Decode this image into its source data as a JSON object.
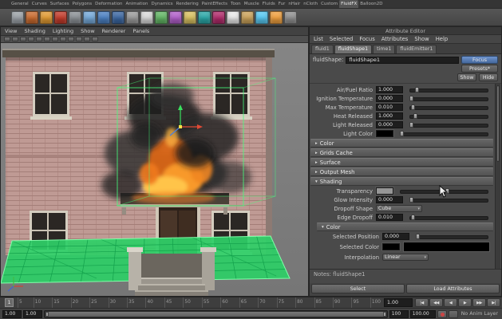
{
  "shelf": {
    "tabs": [
      "General",
      "Curves",
      "Surfaces",
      "Polygons",
      "Deformation",
      "Animation",
      "Dynamics",
      "Rendering",
      "PaintEffects",
      "Toon",
      "Muscle",
      "Fluids",
      "Fur",
      "nHair",
      "nCloth",
      "Custom",
      "FluidFX",
      "Balloon2D"
    ],
    "active_tab": "FluidFX",
    "icon_colors": [
      "#9aa0a6",
      "#c96a2e",
      "#e09a32",
      "#c23b2a",
      "#8a8f94",
      "#74a8d8",
      "#4a7fc1",
      "#3b66a0",
      "#9a9a9a",
      "#d9d9d9",
      "#62b564",
      "#b05fc9",
      "#d8c060",
      "#2aa7a7",
      "#b02a6a",
      "#e8e8e8",
      "#caa25a",
      "#57c8f2",
      "#ef9f3e",
      "#8f8f8f"
    ]
  },
  "viewport": {
    "menu": [
      "View",
      "Shading",
      "Lighting",
      "Show",
      "Renderer",
      "Panels"
    ],
    "toolbar_icons": [
      "select-icon",
      "lasso-icon",
      "paint-select-icon",
      "grid-snap-icon",
      "curve-snap-icon",
      "point-snap-icon",
      "view-snap-icon",
      "make-live-icon",
      "camera-icon",
      "light-icon",
      "texture-icon",
      "wireframe-icon"
    ]
  },
  "attribute_editor": {
    "title": "Attribute Editor",
    "menu": [
      "List",
      "Selected",
      "Focus",
      "Attributes",
      "Show",
      "Help"
    ],
    "tabs": [
      {
        "label": "fluid1",
        "active": false
      },
      {
        "label": "fluidShape1",
        "active": true
      },
      {
        "label": "time1",
        "active": false
      },
      {
        "label": "fluidEmitter1",
        "active": false
      }
    ],
    "node": {
      "label": "fluidShape:",
      "value": "fluidShape1"
    },
    "actions": {
      "focus": "Focus",
      "presets": "Presets*",
      "show": "Show",
      "hide": "Hide"
    },
    "top_rows": [
      {
        "type": "num",
        "label": "Air/Fuel Ratio",
        "value": "1.000",
        "t": 0.08
      },
      {
        "type": "num",
        "label": "Ignition Temperature",
        "value": "0.000",
        "t": 0.0
      },
      {
        "type": "num",
        "label": "Max Temperature",
        "value": "0.010",
        "t": 0.02
      },
      {
        "type": "num",
        "label": "Heat Released",
        "value": "1.000",
        "t": 0.05
      },
      {
        "type": "num",
        "label": "Light Released",
        "value": "0.000",
        "t": 0.0
      },
      {
        "type": "color",
        "label": "Light Color",
        "swatch": "#000000",
        "t": 0.0
      }
    ],
    "collapsed_sections": [
      {
        "label": "Color"
      },
      {
        "label": "Grids Cache"
      },
      {
        "label": "Surface"
      },
      {
        "label": "Output Mesh"
      }
    ],
    "shading": {
      "title": "Shading",
      "rows": [
        {
          "type": "color",
          "label": "Transparency",
          "swatch": "#969696",
          "t": 0.55
        },
        {
          "type": "num",
          "label": "Glow Intensity",
          "value": "0.000",
          "t": 0.0
        },
        {
          "type": "dropdown",
          "label": "Dropoff Shape",
          "value": "Cube"
        },
        {
          "type": "num",
          "label": "Edge Dropoff",
          "value": "0.010",
          "t": 0.02
        }
      ]
    },
    "color_sub": {
      "title": "Color",
      "rows": [
        {
          "type": "num",
          "label": "Selected Position",
          "value": "0.000",
          "t": 0.0
        },
        {
          "type": "colorramp",
          "label": "Selected Color",
          "swatch": "#000000"
        },
        {
          "type": "dropdown",
          "label": "Interpolation",
          "value": "Linear"
        }
      ]
    },
    "notes": "Notes: fluidShape1",
    "footer": {
      "select": "Select",
      "load": "Load Attributes"
    }
  },
  "timeline": {
    "ticks": [
      "5",
      "10",
      "15",
      "20",
      "25",
      "30",
      "35",
      "40",
      "45",
      "50",
      "55",
      "60",
      "65",
      "70",
      "75",
      "80",
      "85",
      "90",
      "95",
      "100"
    ],
    "current_frame": "1",
    "current_time": "1.00",
    "transport": [
      {
        "name": "go-to-start-button",
        "glyph": "|◀"
      },
      {
        "name": "step-back-frame-button",
        "glyph": "◀◀"
      },
      {
        "name": "play-backwards-button",
        "glyph": "◀"
      },
      {
        "name": "play-forwards-button",
        "glyph": "▶"
      },
      {
        "name": "step-forward-frame-button",
        "glyph": "▶▶"
      },
      {
        "name": "go-to-end-button",
        "glyph": "▶|"
      }
    ]
  },
  "range_bar": {
    "start_outer": "1.00",
    "start_inner": "1.00",
    "end_inner": "100",
    "end_outer": "100.00",
    "anim_layer": "No Anim Layer"
  },
  "colors": {
    "accent_blue": "#46699e",
    "selection_green": "#45ff7c",
    "plane_green": "#2ecf67"
  }
}
